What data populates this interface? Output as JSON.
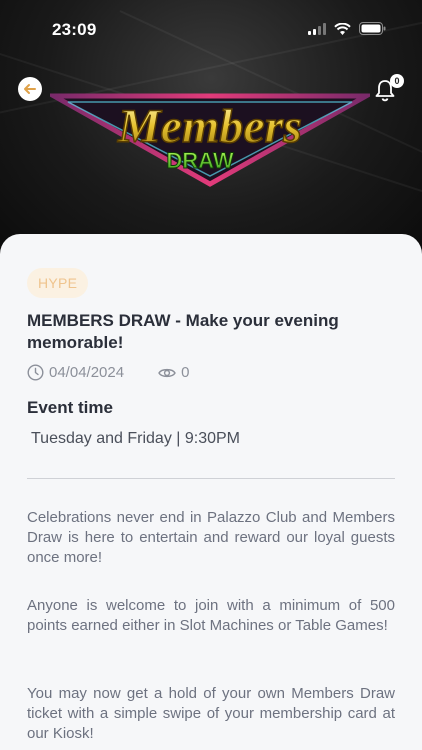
{
  "status": {
    "time": "23:09"
  },
  "header": {
    "logo_text_main": "Members",
    "logo_text_sub": "DRAW",
    "notification_count": "0"
  },
  "article": {
    "tag": "HYPE",
    "title": "MEMBERS DRAW - Make your evening memorable!",
    "date": "04/04/2024",
    "views": "0",
    "event_time_heading": "Event time",
    "event_time_value": "Tuesday and Friday | 9:30PM",
    "paragraphs": [
      "Celebrations never end in Palazzo Club and Members Draw is here to entertain and reward our loyal guests once more!",
      "Anyone is welcome to join with a minimum of 500 points earned either in Slot Machines or Table Games!",
      "You may now get a hold of your own Members Draw ticket with a simple swipe of your membership card at our Kiosk!"
    ]
  },
  "colors": {
    "accent": "#efc48e",
    "tag_bg": "#fbf1e2",
    "card_bg": "#f6f7f9"
  },
  "icons": [
    "signal-icon",
    "wifi-icon",
    "battery-icon",
    "back-arrow-icon",
    "bell-icon",
    "clock-icon",
    "eye-icon"
  ]
}
